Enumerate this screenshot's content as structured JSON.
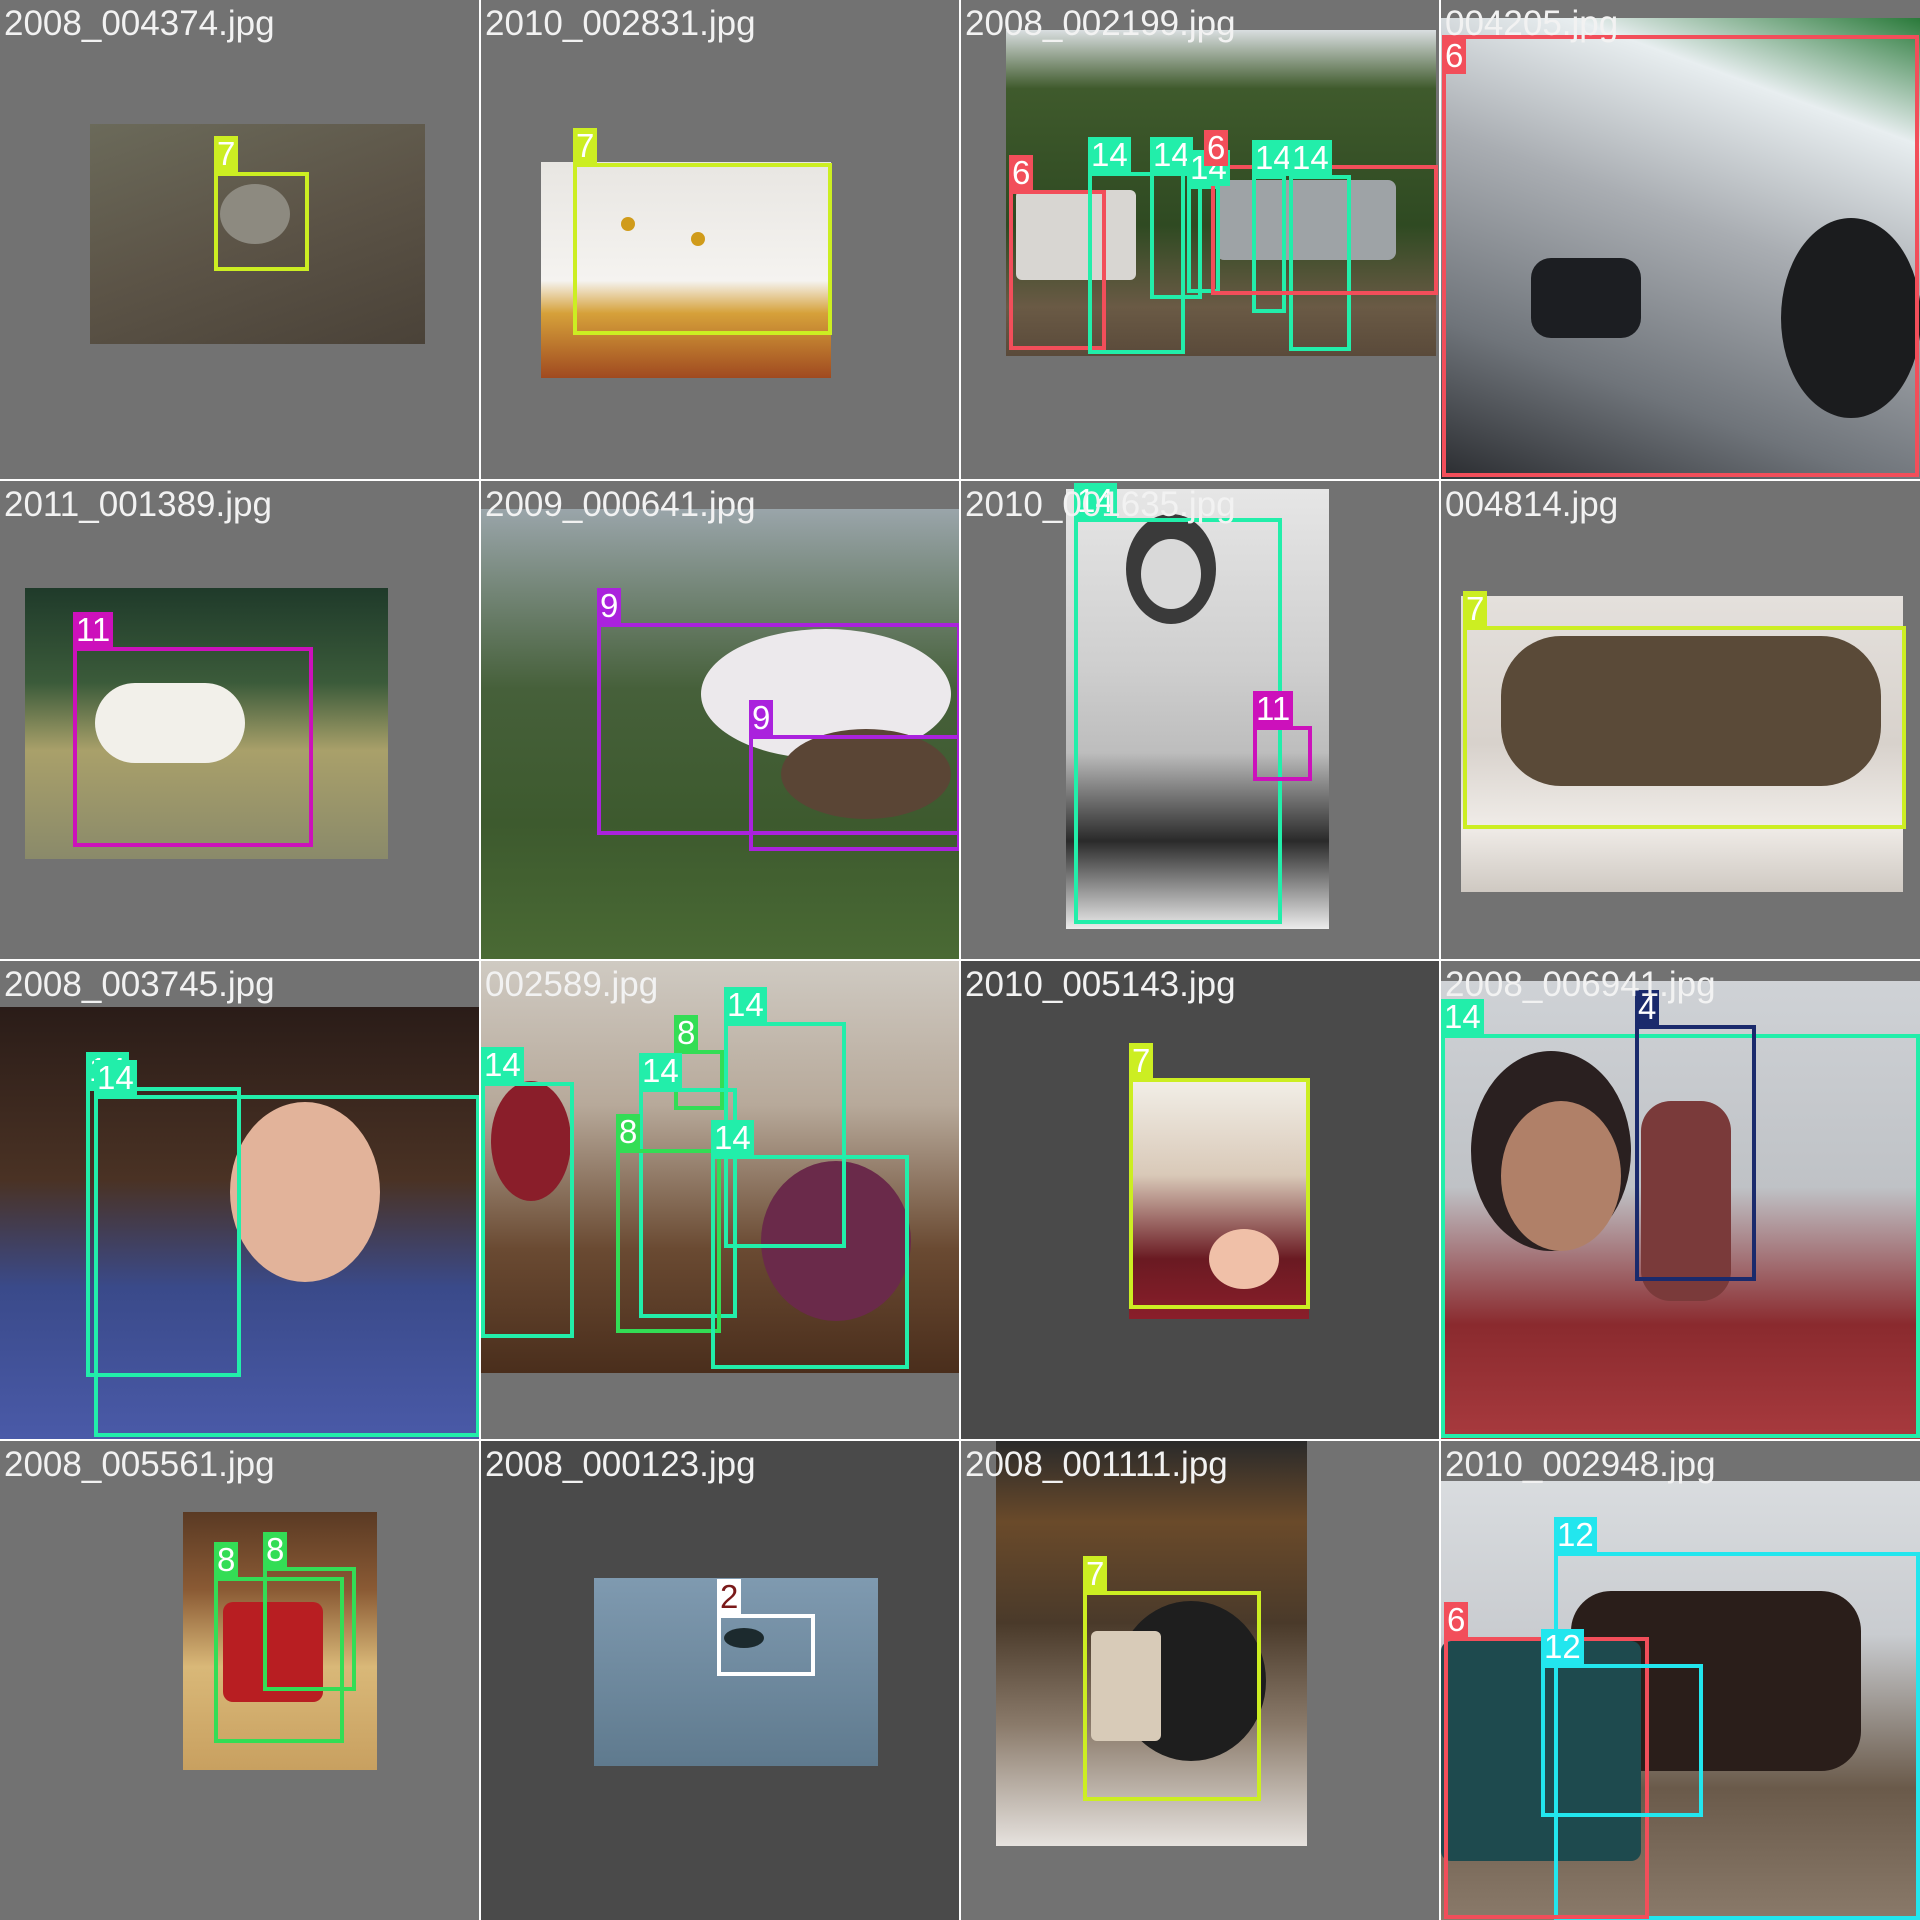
{
  "mosaic": {
    "tiles": [
      {
        "filename": "2008_004374.jpg",
        "labels": [
          "7"
        ]
      },
      {
        "filename": "2010_002831.jpg",
        "labels": [
          "7"
        ]
      },
      {
        "filename": "2008_002199.jpg",
        "labels": [
          "6",
          "14",
          "14",
          "14",
          "14",
          "14",
          "6"
        ]
      },
      {
        "filename": "004205.jpg",
        "labels": [
          "6"
        ]
      },
      {
        "filename": "2011_001389.jpg",
        "labels": [
          "11"
        ]
      },
      {
        "filename": "2009_000641.jpg",
        "labels": [
          "9",
          "9"
        ]
      },
      {
        "filename": "2010_001635.jpg",
        "labels": [
          "14",
          "11"
        ]
      },
      {
        "filename": "004814.jpg",
        "labels": [
          "7"
        ]
      },
      {
        "filename": "2008_003745.jpg",
        "labels": [
          "14",
          "14"
        ]
      },
      {
        "filename": "002589.jpg",
        "labels": [
          "14",
          "8",
          "14",
          "14",
          "8",
          "14"
        ]
      },
      {
        "filename": "2010_005143.jpg",
        "labels": [
          "7"
        ]
      },
      {
        "filename": "2008_006941.jpg",
        "labels": [
          "14",
          "4"
        ]
      },
      {
        "filename": "2008_005561.jpg",
        "labels": [
          "8",
          "8"
        ]
      },
      {
        "filename": "2008_000123.jpg",
        "labels": [
          "2"
        ]
      },
      {
        "filename": "2008_001111.jpg",
        "labels": [
          "7"
        ]
      },
      {
        "filename": "2010_002948.jpg",
        "labels": [
          "12",
          "6",
          "12"
        ]
      }
    ]
  },
  "colors": {
    "background": "#ffffff",
    "tile_bg": "#727272",
    "class_2": "#ffffff",
    "class_4": "#1a2a6c",
    "class_6": "#f24e5a",
    "class_7": "#ccee22",
    "class_8": "#33dd55",
    "class_9": "#aa22dd",
    "class_11": "#cc11bb",
    "class_12": "#22e6ee",
    "class_14": "#22eeaa"
  }
}
